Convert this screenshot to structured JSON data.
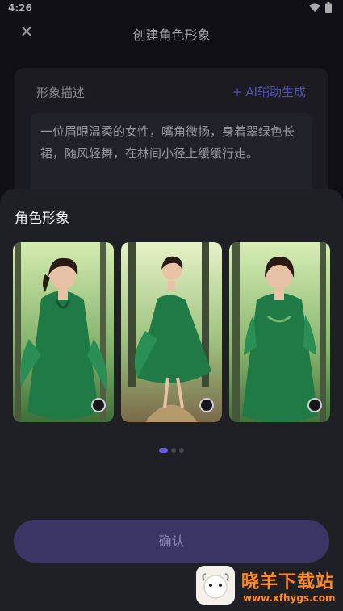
{
  "status_bar": {
    "time": "4:26",
    "wifi_icon": "wifi-icon",
    "battery_icon": "battery-icon"
  },
  "header": {
    "title": "创建角色形象",
    "close_icon": "close-icon"
  },
  "description": {
    "label": "形象描述",
    "ai_button": "AI辅助生成",
    "text": "一位眉眼温柔的女性，嘴角微扬，身着翠绿色长裙，随风轻舞，在林间小径上缓缓行走。"
  },
  "sheet": {
    "title": "角色形象",
    "images": [
      {
        "name": "character-image-1",
        "selected": false
      },
      {
        "name": "character-image-2",
        "selected": false
      },
      {
        "name": "character-image-3",
        "selected": false
      }
    ],
    "pager": {
      "count": 3,
      "active": 0
    },
    "confirm_button": "确认"
  },
  "watermark": {
    "title": "晓羊下载站",
    "url": "www.xfhygs.com"
  },
  "colors": {
    "accent": "#6b5ce6",
    "confirm_bg": "#3b3566",
    "dress_green": "#1f7a45",
    "watermark_orange": "#ff8a1c"
  }
}
